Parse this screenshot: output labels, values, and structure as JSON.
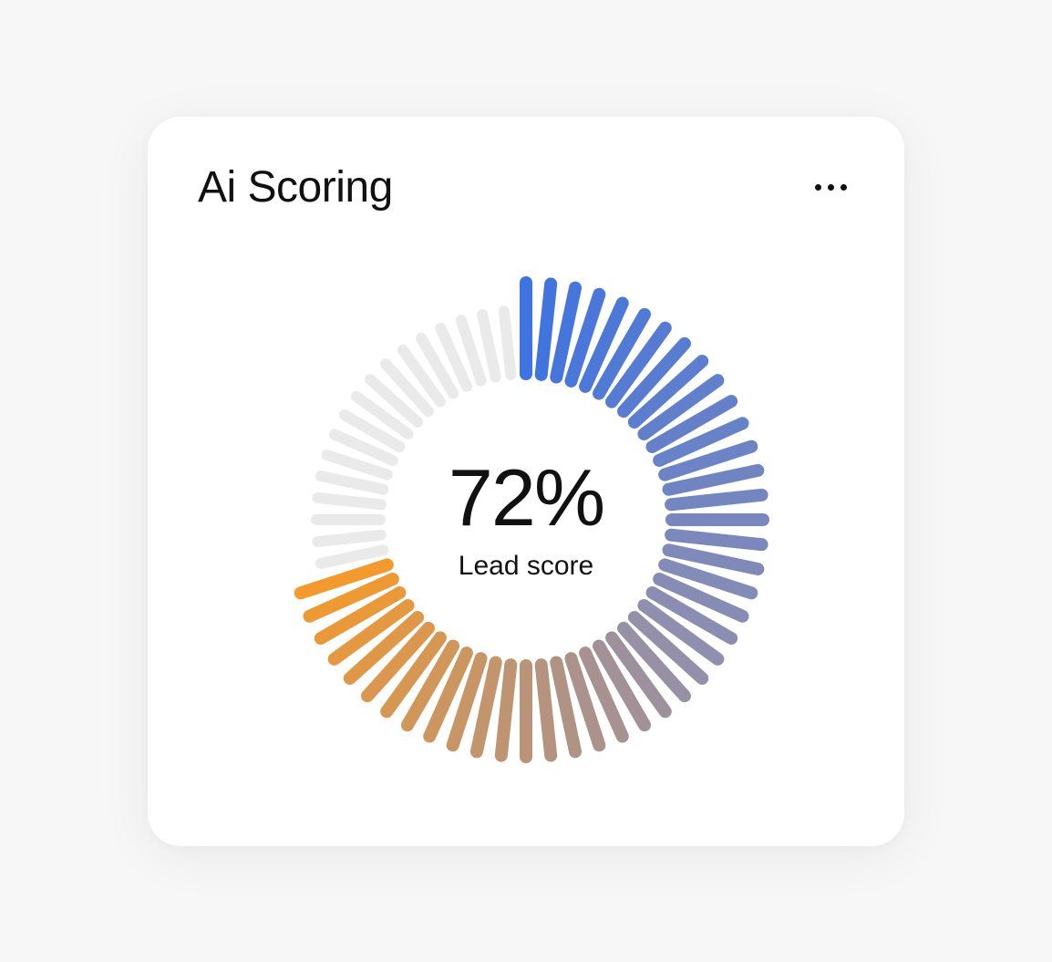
{
  "card": {
    "title": "Ai Scoring",
    "value_text": "72%",
    "label": "Lead score"
  },
  "chart_data": {
    "type": "pie",
    "title": "Ai Scoring",
    "label": "Lead score",
    "value": 72,
    "max": 100,
    "unit": "%",
    "gradient_colors": {
      "start": "#3e73e0",
      "mid": "#8f8fb0",
      "end": "#f29a2e",
      "inactive": "#eaeaea"
    },
    "segments_total": 60
  }
}
